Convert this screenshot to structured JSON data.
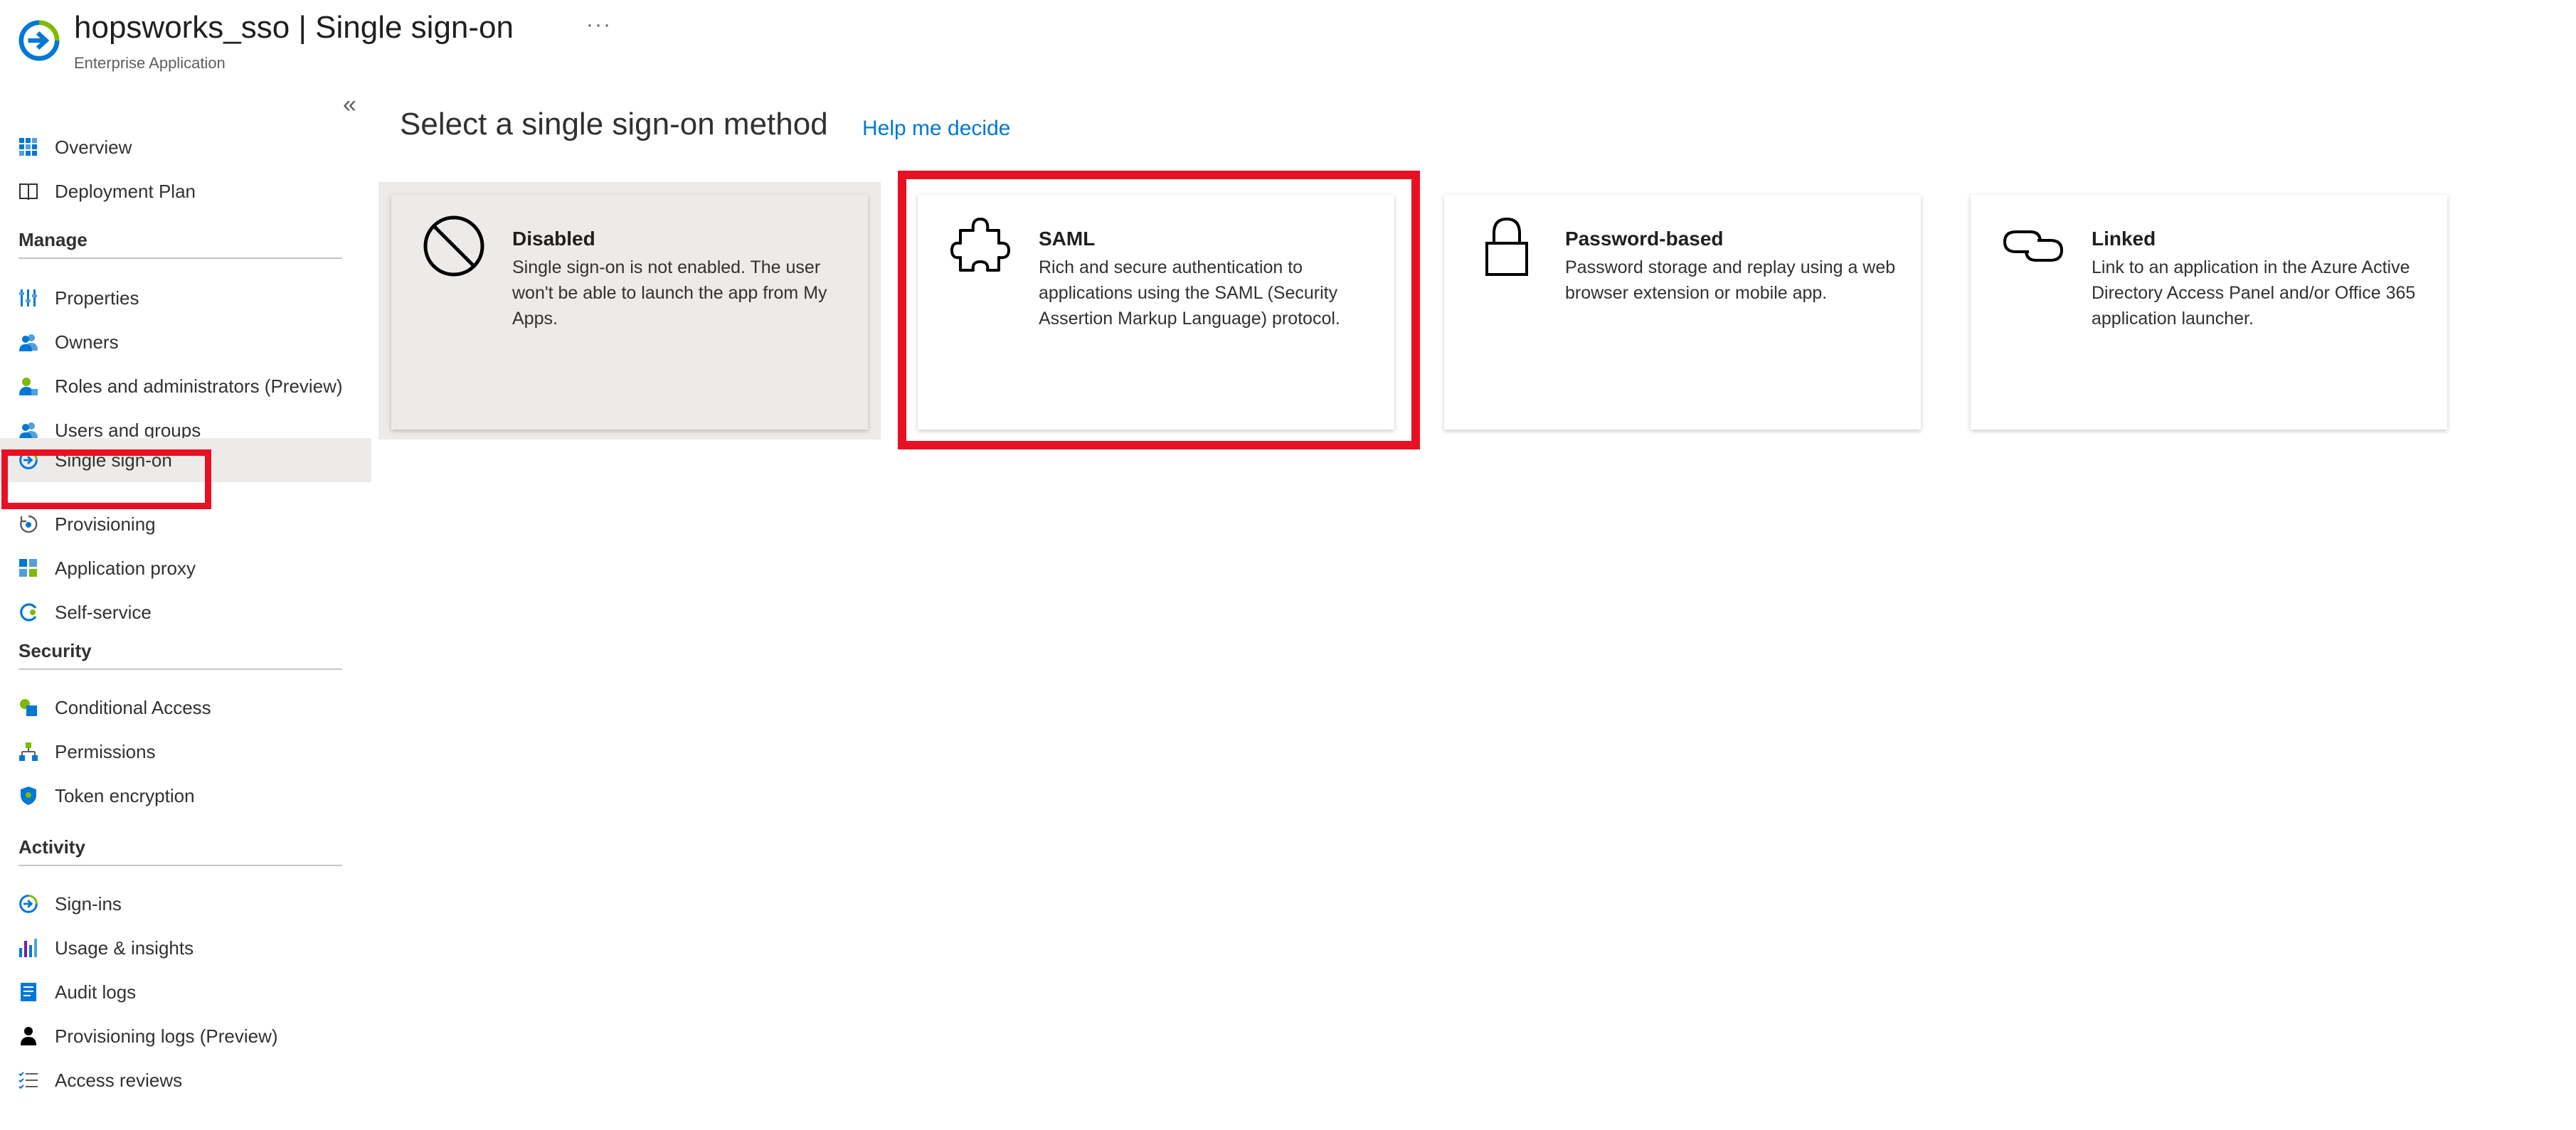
{
  "header": {
    "title": "hopsworks_sso | Single sign-on",
    "subtitle": "Enterprise Application",
    "more_label": "···"
  },
  "sidebar": {
    "collapse_label": "«",
    "top_items": [
      {
        "label": "Overview",
        "icon": "overview-grid-icon"
      },
      {
        "label": "Deployment Plan",
        "icon": "book-icon"
      }
    ],
    "sections": [
      {
        "title": "Manage",
        "items": [
          {
            "label": "Properties",
            "icon": "properties-icon"
          },
          {
            "label": "Owners",
            "icon": "owners-icon"
          },
          {
            "label": "Roles and administrators (Preview)",
            "icon": "roles-icon"
          },
          {
            "label": "Users and groups",
            "icon": "users-groups-icon"
          },
          {
            "label": "Single sign-on",
            "icon": "single-sign-on-icon",
            "active": true
          },
          {
            "label": "Provisioning",
            "icon": "provisioning-icon"
          },
          {
            "label": "Application proxy",
            "icon": "application-proxy-icon"
          },
          {
            "label": "Self-service",
            "icon": "self-service-icon"
          }
        ]
      },
      {
        "title": "Security",
        "items": [
          {
            "label": "Conditional Access",
            "icon": "conditional-access-icon"
          },
          {
            "label": "Permissions",
            "icon": "permissions-icon"
          },
          {
            "label": "Token encryption",
            "icon": "shield-icon"
          }
        ]
      },
      {
        "title": "Activity",
        "items": [
          {
            "label": "Sign-ins",
            "icon": "sign-ins-icon"
          },
          {
            "label": "Usage & insights",
            "icon": "bar-chart-icon"
          },
          {
            "label": "Audit logs",
            "icon": "audit-logs-icon"
          },
          {
            "label": "Provisioning logs (Preview)",
            "icon": "person-icon"
          },
          {
            "label": "Access reviews",
            "icon": "checklist-icon"
          }
        ]
      }
    ]
  },
  "main": {
    "heading": "Select a single sign-on method",
    "help_link": "Help me decide",
    "cards": [
      {
        "title": "Disabled",
        "description": "Single sign-on is not enabled. The user won't be able to launch the app from My Apps.",
        "icon": "prohibited-icon"
      },
      {
        "title": "SAML",
        "description": "Rich and secure authentication to applications using the SAML (Security Assertion Markup Language) protocol.",
        "icon": "puzzle-icon"
      },
      {
        "title": "Password-based",
        "description": "Password storage and replay using a web browser extension or mobile app.",
        "icon": "lock-icon"
      },
      {
        "title": "Linked",
        "description": "Link to an application in the Azure Active Directory Access Panel and/or Office 365 application launcher.",
        "icon": "link-icon"
      }
    ]
  },
  "colors": {
    "accent": "#0078d4",
    "highlight": "#e81123",
    "selected_bg": "#edebe9"
  }
}
